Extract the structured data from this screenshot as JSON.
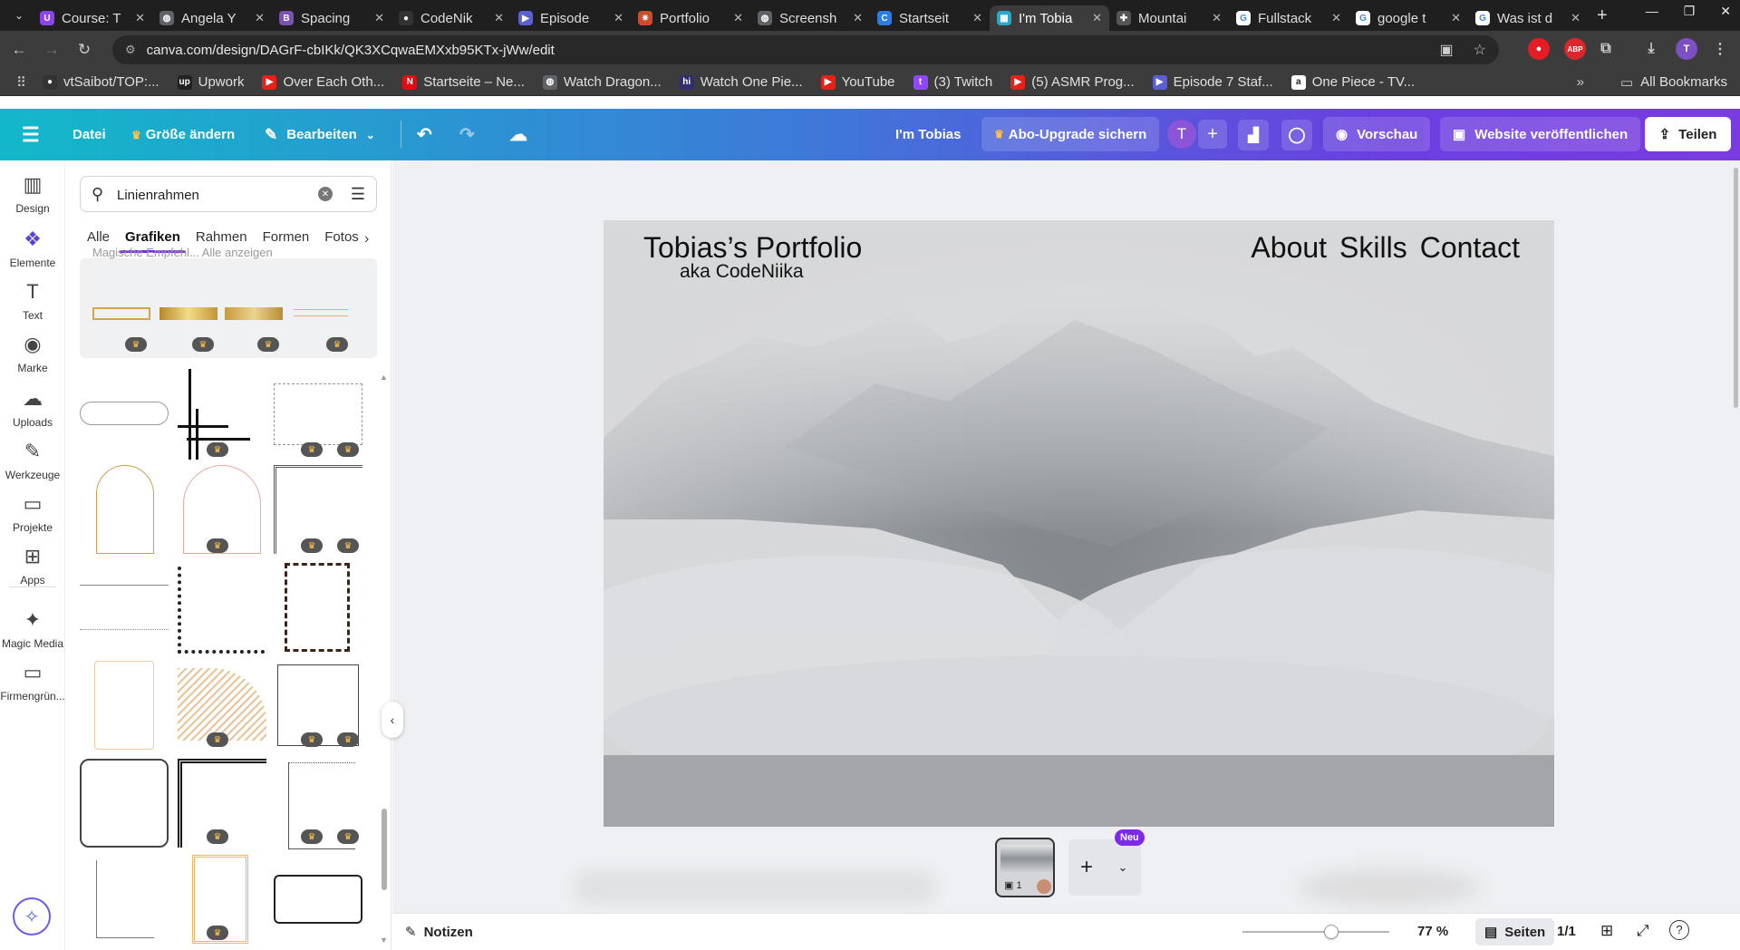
{
  "browser": {
    "tabs": [
      {
        "label": "Course: T",
        "color": "#8e44ec",
        "glyph": "U"
      },
      {
        "label": "Angela Y",
        "color": "#5f6368",
        "glyph": "◍"
      },
      {
        "label": "Spacing",
        "color": "#7952b3",
        "glyph": "B"
      },
      {
        "label": "CodeNik",
        "color": "#333333",
        "glyph": "●"
      },
      {
        "label": "Episode",
        "color": "#5b5fd6",
        "glyph": "▶"
      },
      {
        "label": "Portfolio",
        "color": "#d04a2b",
        "glyph": "✷"
      },
      {
        "label": "Screensh",
        "color": "#5f6368",
        "glyph": "◍"
      },
      {
        "label": "Startseit",
        "color": "#2d7be5",
        "glyph": "C"
      },
      {
        "label": "I'm Tobia",
        "color": "#2aa8c9",
        "glyph": "▦"
      },
      {
        "label": "Mountai",
        "color": "#555555",
        "glyph": "✚"
      },
      {
        "label": "Fullstack",
        "color": "#ffffff",
        "glyph": "G"
      },
      {
        "label": "google t",
        "color": "#ffffff",
        "glyph": "G"
      },
      {
        "label": "Was ist d",
        "color": "#ffffff",
        "glyph": "G"
      }
    ],
    "active_tab": 8,
    "new_tab": "+",
    "url": "canva.com/design/DAGrF-cbIKk/QK3XCqwaEMXxb95KTx-jWw/edit",
    "bookmarks": [
      {
        "label": "vtSaibot/TOP:...",
        "color": "#333333",
        "glyph": "●"
      },
      {
        "label": "Upwork",
        "color": "#222222",
        "glyph": "up"
      },
      {
        "label": "Over Each Oth...",
        "color": "#e62117",
        "glyph": "▶"
      },
      {
        "label": "Startseite – Ne...",
        "color": "#e50914",
        "glyph": "N"
      },
      {
        "label": "Watch Dragon...",
        "color": "#5f6368",
        "glyph": "◍"
      },
      {
        "label": "Watch One Pie...",
        "color": "#2f2f6f",
        "glyph": "hi"
      },
      {
        "label": "YouTube",
        "color": "#e62117",
        "glyph": "▶"
      },
      {
        "label": "(3) Twitch",
        "color": "#9146ff",
        "glyph": "t"
      },
      {
        "label": "(5) ASMR Prog...",
        "color": "#e62117",
        "glyph": "▶"
      },
      {
        "label": "Episode 7 Staf...",
        "color": "#5b5fd6",
        "glyph": "▶"
      },
      {
        "label": "One Piece - TV...",
        "color": "#ffffff",
        "glyph": "a"
      }
    ],
    "all_bookmarks": "All Bookmarks",
    "profile_initial": "T"
  },
  "canva": {
    "header": {
      "file": "Datei",
      "resize": "Größe ändern",
      "edit": "Bearbeiten",
      "doc_title": "I'm Tobias",
      "upgrade": "Abo-Upgrade sichern",
      "avatar_initial": "T",
      "preview": "Vorschau",
      "publish": "Website veröffentlichen",
      "share": "Teilen"
    },
    "rail": [
      {
        "label": "Design",
        "icon": "▥"
      },
      {
        "label": "Elemente",
        "icon": "❖"
      },
      {
        "label": "Text",
        "icon": "T"
      },
      {
        "label": "Marke",
        "icon": "◉"
      },
      {
        "label": "Uploads",
        "icon": "☁"
      },
      {
        "label": "Werkzeuge",
        "icon": "✎"
      },
      {
        "label": "Projekte",
        "icon": "▭"
      },
      {
        "label": "Apps",
        "icon": "⊞"
      },
      {
        "label": "Magic Media",
        "icon": "✦"
      },
      {
        "label": "Firmengrün...",
        "icon": "▭"
      }
    ],
    "search": {
      "value": "Linienrahmen",
      "placeholder": "Linienrahmen"
    },
    "categories": [
      "Alle",
      "Grafiken",
      "Rahmen",
      "Formen",
      "Fotos"
    ],
    "active_category": 1,
    "faded_row": "Magische Empfehl...   Alle anzeigen",
    "premium_badge": "♛",
    "website": {
      "title": "Tobias’s Portfolio",
      "subtitle": "aka CodeNiika",
      "nav": [
        "About",
        "Skills",
        "Contact"
      ]
    },
    "page_thumb_number": "1",
    "new_badge": "Neu",
    "notes": "Notizen",
    "zoom": "77 %",
    "pages_label": "Seiten",
    "page_count": "1/1"
  }
}
